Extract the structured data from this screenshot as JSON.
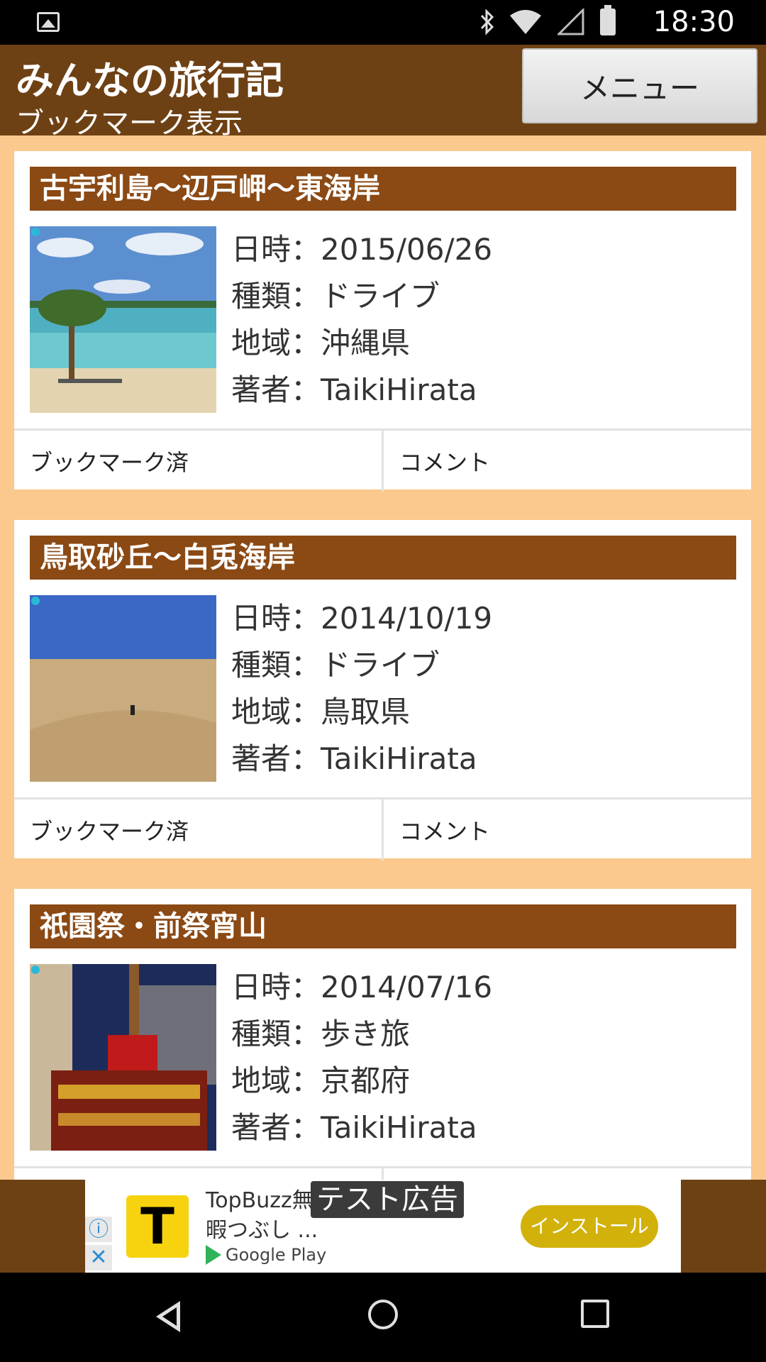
{
  "status_bar": {
    "time": "18:30"
  },
  "header": {
    "title": "みんなの旅行記",
    "subtitle": "ブックマーク表示",
    "menu_label": "メニュー"
  },
  "entries": [
    {
      "title": "古宇利島〜辺戸岬〜東海岸",
      "date": "日時：2015/06/26",
      "type": "種類：ドライブ",
      "region": "地域：沖縄県",
      "author": "著者：TaikiHirata",
      "bookmark_label": "ブックマーク済",
      "comment_label": "コメント"
    },
    {
      "title": "鳥取砂丘〜白兎海岸",
      "date": "日時：2014/10/19",
      "type": "種類：ドライブ",
      "region": "地域：鳥取県",
      "author": "著者：TaikiHirata",
      "bookmark_label": "ブックマーク済",
      "comment_label": "コメント"
    },
    {
      "title": "祇園祭・前祭宵山",
      "date": "日時：2014/07/16",
      "type": "種類：歩き旅",
      "region": "地域：京都府",
      "author": "著者：TaikiHirata",
      "bookmark_label": "",
      "comment_label": ""
    }
  ],
  "ad": {
    "title": "TopBuzz無",
    "desc": "暇つぶし ...",
    "store": "Google Play",
    "tag": "テスト広告",
    "install_label": "インストール",
    "logo_letter": "T"
  },
  "colors": {
    "header_bg": "#6e4114",
    "card_title_bg": "#8b4914",
    "page_bg": "#fbc98d",
    "install_bg": "#d2b10b"
  }
}
